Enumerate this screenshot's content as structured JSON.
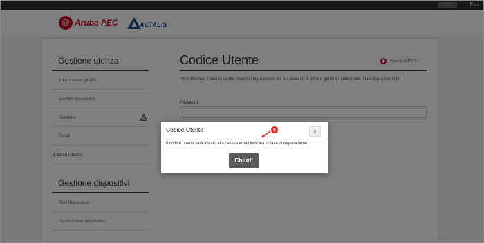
{
  "topbar": {
    "logout_label": "Esci"
  },
  "header": {
    "logo_aruba": "Aruba PEC",
    "logo_actalis": "ACTALIS"
  },
  "sidebar": {
    "section1_title": "Gestione utenza",
    "section1_items": [
      {
        "label": "Informazioni profilo"
      },
      {
        "label": "Cambio password"
      },
      {
        "label": "Telefono",
        "icon": "warning-icon"
      },
      {
        "label": "Email"
      },
      {
        "label": "Codice Utente",
        "active": true
      }
    ],
    "section2_title": "Gestione dispositivi",
    "section2_items": [
      {
        "label": "Test dispositivo"
      },
      {
        "label": "Sostituzione dispositivo"
      }
    ]
  },
  "main": {
    "title": "Codice Utente",
    "help_label": "Ti serve AIUTO?",
    "description": "Per richiedere il codice utente, inserisci la password del tuo account di firma e genera il codice con il tuo dispositivo OTP",
    "password_label": "Password:",
    "password_value": ""
  },
  "modal": {
    "title": "Codice Utente",
    "close_glyph": "×",
    "body": "Il codice utente sarà inviato alla casella email indicata in fase di registrazione.",
    "button_label": "Chiudi"
  },
  "annotation": {
    "step_number": "6",
    "color": "#e0201c"
  },
  "colors": {
    "brand_red": "#c8102e",
    "actalis_blue": "#1f4e8c",
    "button_gray": "#5a5a5a"
  }
}
